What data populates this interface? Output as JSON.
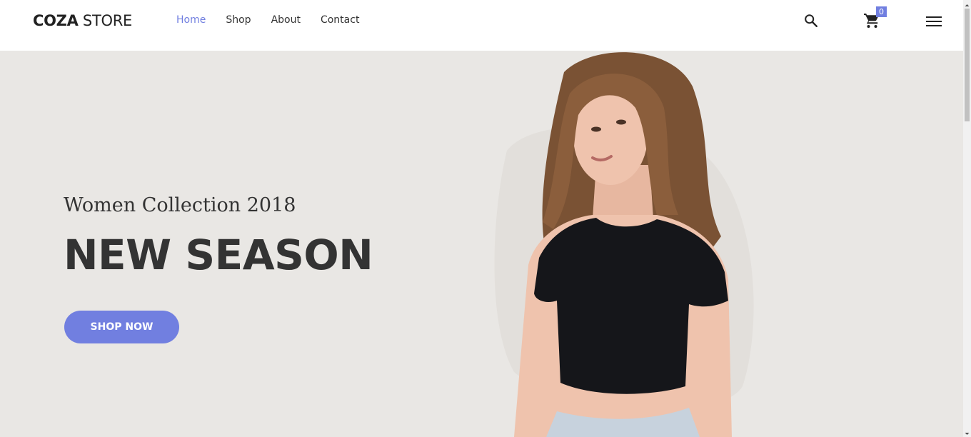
{
  "header": {
    "logo": {
      "bold": "COZA",
      "normal": " STORE"
    },
    "nav": [
      {
        "label": "Home",
        "active": true
      },
      {
        "label": "Shop",
        "active": false
      },
      {
        "label": "About",
        "active": false
      },
      {
        "label": "Contact",
        "active": false
      }
    ],
    "icons": {
      "search": "search-icon",
      "cart": "cart-icon",
      "menu": "hamburger-menu-icon"
    },
    "cart_count": "0"
  },
  "hero": {
    "subtitle": "Women Collection 2018",
    "headline": "NEW SEASON",
    "cta_label": "SHOP NOW",
    "image": "model-in-black-crop-top"
  },
  "colors": {
    "accent": "#717fe0",
    "hero_bg": "#e9e7e4",
    "text_dark": "#333333"
  }
}
